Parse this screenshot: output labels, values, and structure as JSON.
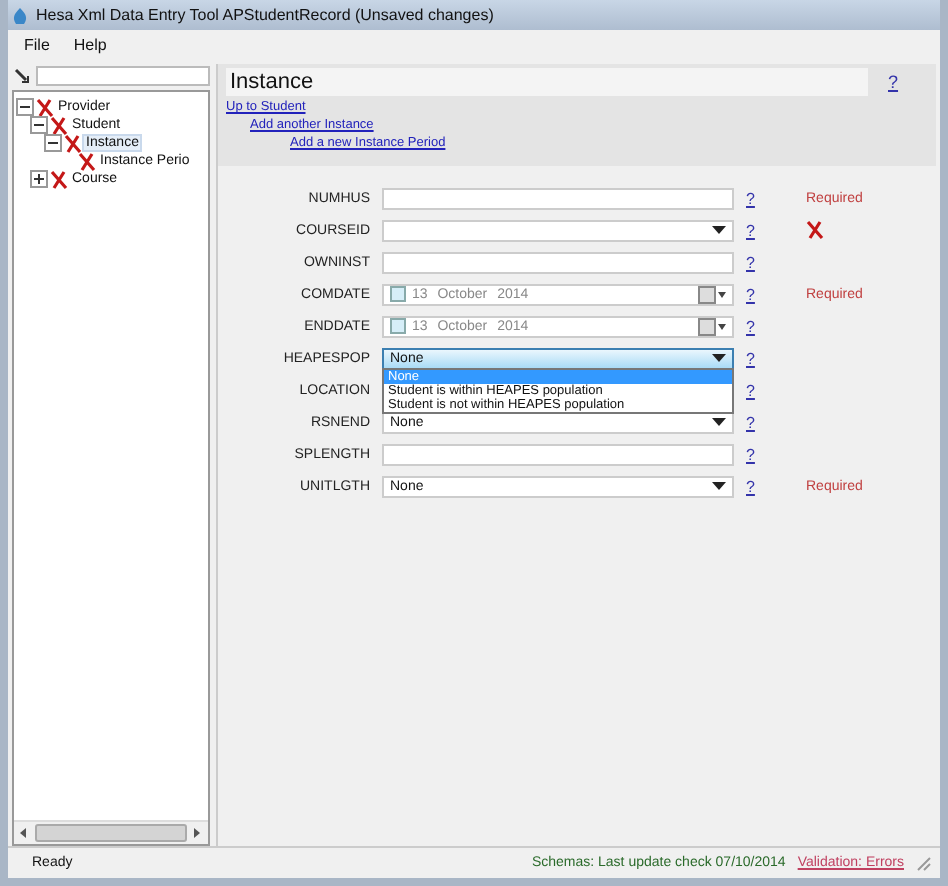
{
  "window": {
    "title": "Hesa Xml Data Entry Tool APStudentRecord (Unsaved changes)"
  },
  "menu": [
    "File",
    "Help"
  ],
  "tree": [
    {
      "label": "Provider",
      "expanded": true,
      "selected": false,
      "children": [
        {
          "label": "Student",
          "expanded": true,
          "selected": false,
          "children": [
            {
              "label": "Instance",
              "expanded": true,
              "selected": true,
              "children": [
                {
                  "label": "Instance Perio",
                  "selected": false
                }
              ]
            }
          ]
        },
        {
          "label": "Course",
          "expanded": false,
          "selected": false
        }
      ]
    }
  ],
  "panel": {
    "title": "Instance",
    "help": "?",
    "links": [
      "Up to Student",
      "Add another Instance",
      "Add a new Instance Period"
    ]
  },
  "fields": [
    {
      "label": "NUMHUS",
      "kind": "text",
      "help": "?",
      "note": "Required"
    },
    {
      "label": "COURSEID",
      "kind": "combo",
      "help": "?",
      "error": true
    },
    {
      "label": "OWNINST",
      "kind": "text",
      "help": "?"
    },
    {
      "label": "COMDATE",
      "kind": "date",
      "value": "13  October  2014",
      "checked": false,
      "help": "?",
      "note": "Required"
    },
    {
      "label": "ENDDATE",
      "kind": "date",
      "value": "13  October  2014",
      "checked": false,
      "help": "?"
    },
    {
      "label": "HEAPESPOP",
      "kind": "combo",
      "value": "None",
      "focused": true,
      "expanded": true,
      "help": "?",
      "options": [
        {
          "label": "None",
          "selected": true
        },
        {
          "label": "Student is within HEAPES population",
          "selected": false
        },
        {
          "label": "Student is not within HEAPES population",
          "selected": false
        }
      ]
    },
    {
      "label": "LOCATION",
      "kind": "hidden",
      "help": "?"
    },
    {
      "label": "RSNEND",
      "kind": "combo",
      "value": "None",
      "help": "?"
    },
    {
      "label": "SPLENGTH",
      "kind": "text",
      "help": "?"
    },
    {
      "label": "UNITLGTH",
      "kind": "combo",
      "value": "None",
      "help": "?",
      "note": "Required"
    }
  ],
  "status_bar": {
    "ready": "Ready",
    "schemas": "Schemas: Last update check 07/10/2014",
    "validation": "Validation: Errors"
  }
}
